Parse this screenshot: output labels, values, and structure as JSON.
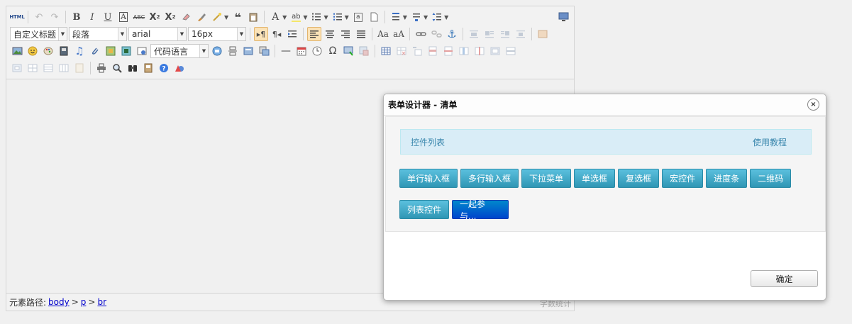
{
  "toolbar": {
    "html_label": "HTML",
    "heading_select": "自定义标题",
    "paragraph_select": "段落",
    "font_select": "arial",
    "size_select": "16px",
    "code_lang_select": "代码语言"
  },
  "statusbar": {
    "path_label": "元素路径:",
    "path": [
      "body",
      "p",
      "br"
    ],
    "word_count": "字数统计"
  },
  "dialog": {
    "title": "表单设计器 - 清单",
    "close_symbol": "×",
    "panel_title": "控件列表",
    "tutorial_link": "使用教程",
    "controls_row1": [
      "单行输入框",
      "多行输入框",
      "下拉菜单",
      "单选框",
      "复选框",
      "宏控件",
      "进度条",
      "二维码"
    ],
    "controls_row2": [
      "列表控件",
      "一起参与..."
    ],
    "ok_label": "确定"
  }
}
